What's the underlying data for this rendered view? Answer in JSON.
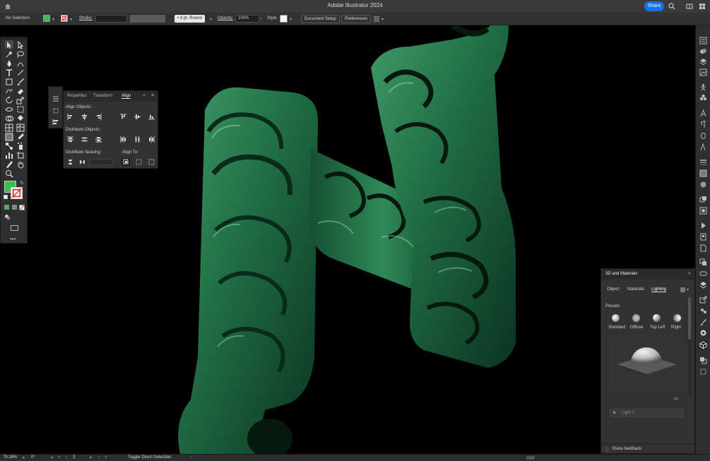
{
  "window": {
    "title": "Adobe Illustrator 2024",
    "share_label": "Share"
  },
  "control_bar": {
    "selection_status": "No Selection",
    "stroke_label": "Stroke:",
    "brush_value": "3 pt. Round",
    "opacity_label": "Opacity:",
    "opacity_value": "100%",
    "style_label": "Style:",
    "document_setup_label": "Document Setup",
    "preferences_label": "Preferences",
    "fill_color": "#3dbd4d"
  },
  "align_panel": {
    "tabs": [
      "Properties",
      "Transform",
      "Align"
    ],
    "active_tab": "Align",
    "align_objects_label": "Align Objects:",
    "distribute_objects_label": "Distribute Objects:",
    "distribute_spacing_label": "Distribute Spacing:",
    "align_to_label": "Align To:"
  },
  "panel_3d": {
    "title": "3D and Materials",
    "tabs": [
      "Object",
      "Materials",
      "Lighting"
    ],
    "active_tab": "Lighting",
    "presets_label": "Presets",
    "presets": [
      "Standard",
      "Diffuse",
      "Top Left",
      "Right"
    ],
    "light_name": "Light 1",
    "share_feedback_label": "Share feedback"
  },
  "status_bar": {
    "zoom": "79.28%",
    "rotation": "0°",
    "artboard": "3",
    "tool_hint": "Toggle Direct Selection"
  },
  "colors": {
    "jade_dark": "#0f3a24",
    "jade_mid": "#1f6b43",
    "jade_light": "#5fb585",
    "accent_blue": "#1473e6"
  }
}
